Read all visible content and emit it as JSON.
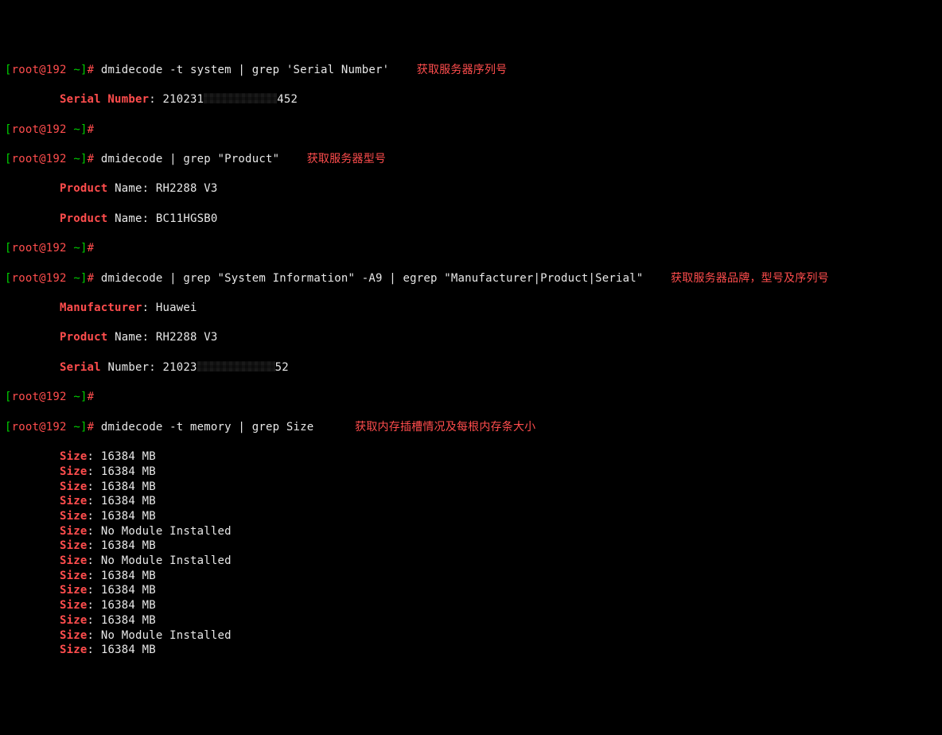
{
  "prompt": {
    "user": "root",
    "at": "@",
    "host": "192",
    "tilde": " ~",
    "hash": "# "
  },
  "cmd1": {
    "text": "dmidecode -t system | grep 'Serial Number'",
    "anno": "获取服务器序列号",
    "out_key": "Serial Number",
    "out_colon": ": ",
    "out_val_pre": "210231",
    "out_val_post": "452"
  },
  "cmd2": {
    "text": "dmidecode | grep \"Product\"",
    "anno": "获取服务器型号",
    "rows": [
      {
        "key": "Product",
        "rest": " Name: RH2288 V3"
      },
      {
        "key": "Product",
        "rest": " Name: BC11HGSB0"
      }
    ]
  },
  "cmd3": {
    "text": "dmidecode | grep \"System Information\" -A9 | egrep \"Manufacturer|Product|Serial\"",
    "anno": "获取服务器品牌，型号及序列号",
    "r1_key": "Manufacturer",
    "r1_rest": ": Huawei",
    "r2_key": "Product",
    "r2_rest": " Name: RH2288 V3",
    "r3_key": "Serial",
    "r3_rest_pre": " Number: 21023",
    "r3_rest_post": "52"
  },
  "cmd4": {
    "text": "dmidecode -t memory | grep Size",
    "anno": "获取内存插槽情况及每根内存条大小",
    "rows": [
      "16384 MB",
      "16384 MB",
      "16384 MB",
      "16384 MB",
      "16384 MB",
      "No Module Installed",
      "16384 MB",
      "No Module Installed",
      "16384 MB",
      "16384 MB",
      "16384 MB",
      "16384 MB",
      "No Module Installed",
      "16384 MB"
    ],
    "size_key": "Size",
    "size_colon": ": "
  },
  "lb": "[",
  "rb": "]"
}
